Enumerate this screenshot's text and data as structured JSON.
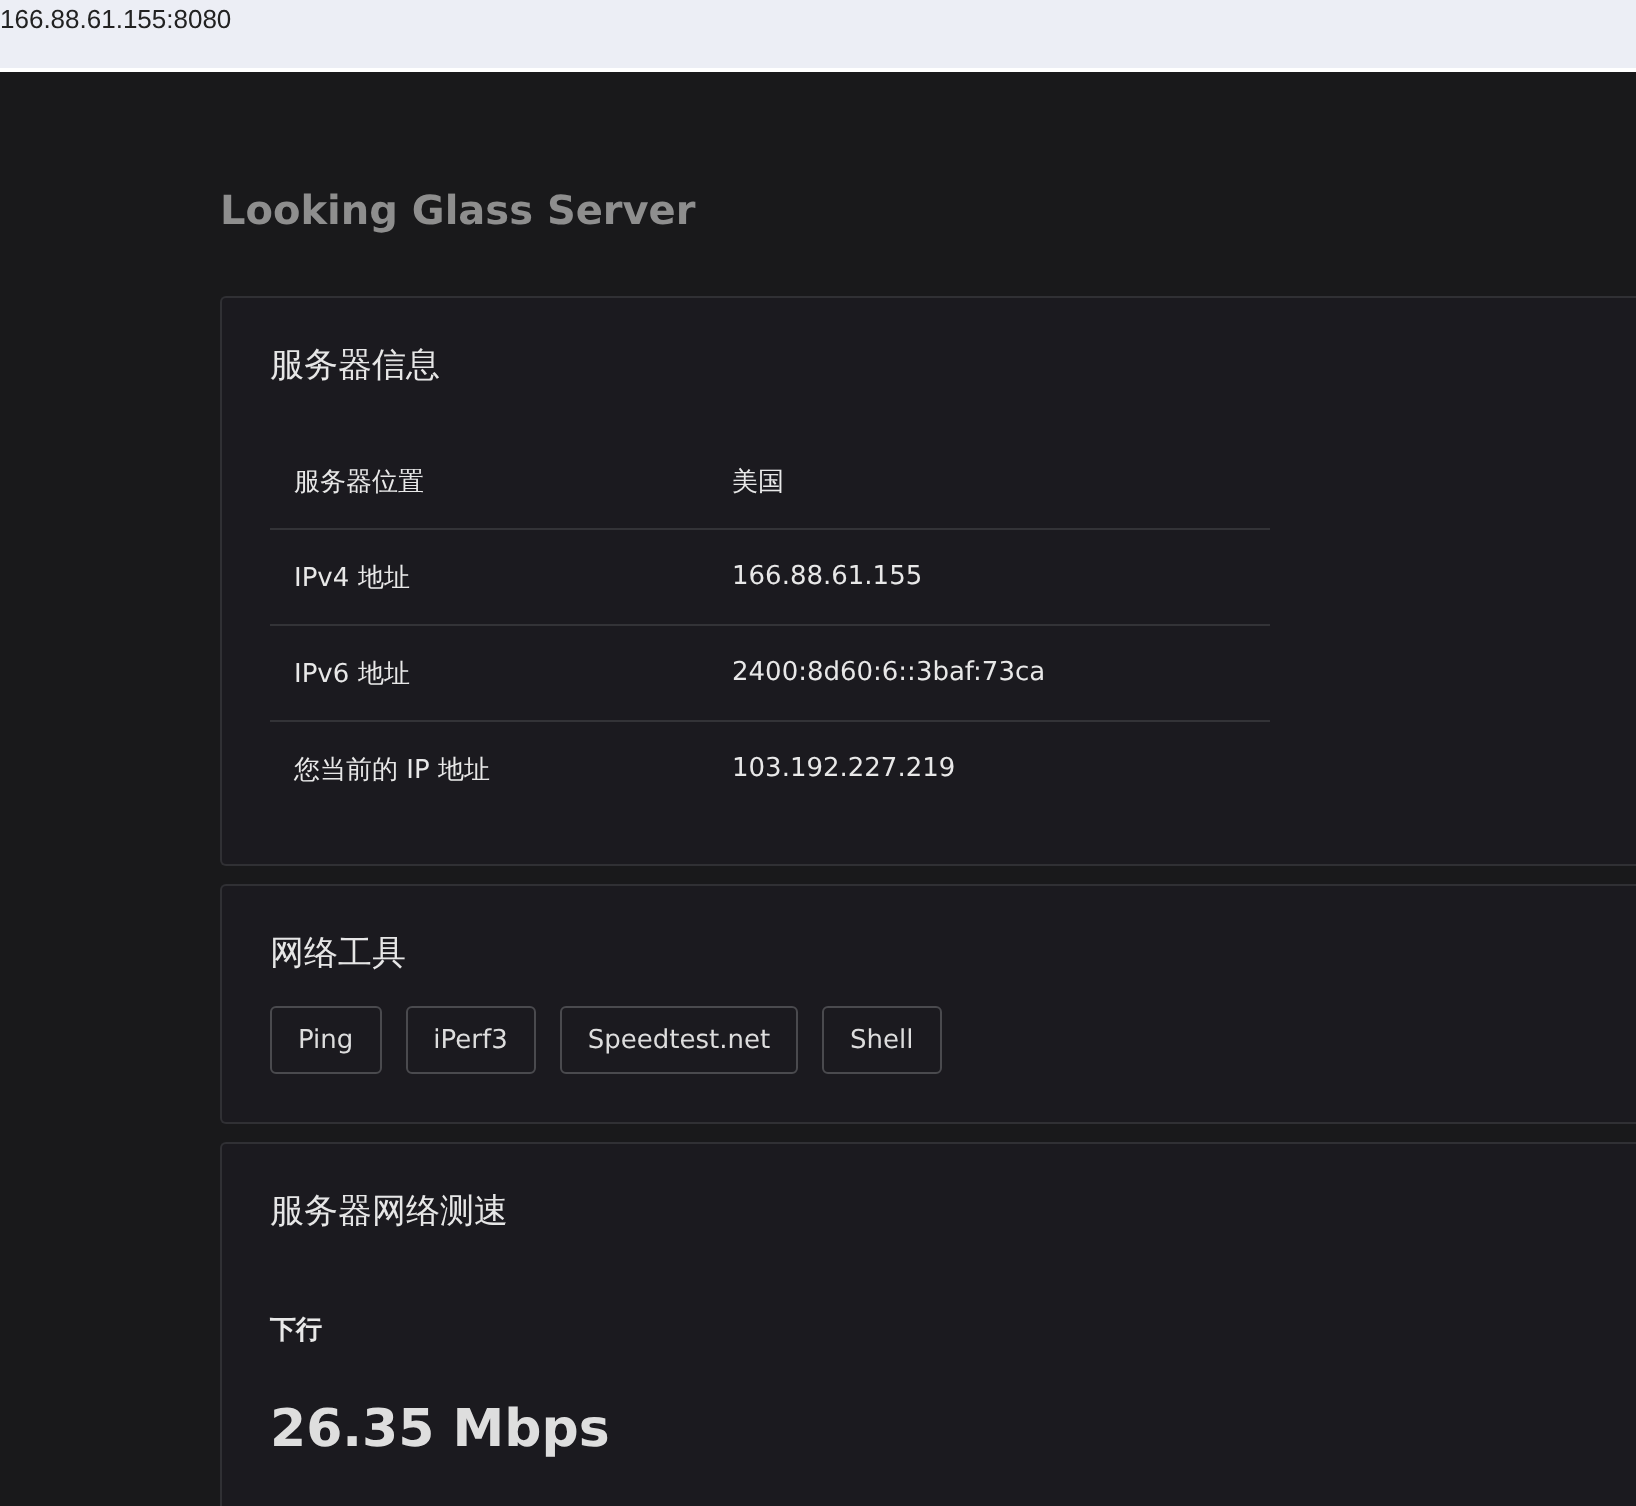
{
  "address_bar": {
    "url": "166.88.61.155:8080"
  },
  "page_title": "Looking Glass Server",
  "server_info": {
    "title": "服务器信息",
    "rows": [
      {
        "label": "服务器位置",
        "value": "美国"
      },
      {
        "label": "IPv4 地址",
        "value": "166.88.61.155"
      },
      {
        "label": "IPv6 地址",
        "value": "2400:8d60:6::3baf:73ca"
      },
      {
        "label": "您当前的 IP 地址",
        "value": "103.192.227.219"
      }
    ]
  },
  "network_tools": {
    "title": "网络工具",
    "buttons": [
      "Ping",
      "iPerf3",
      "Speedtest.net",
      "Shell"
    ]
  },
  "speed_test": {
    "title": "服务器网络测速",
    "label": "下行",
    "value": "26.35 Mbps"
  }
}
